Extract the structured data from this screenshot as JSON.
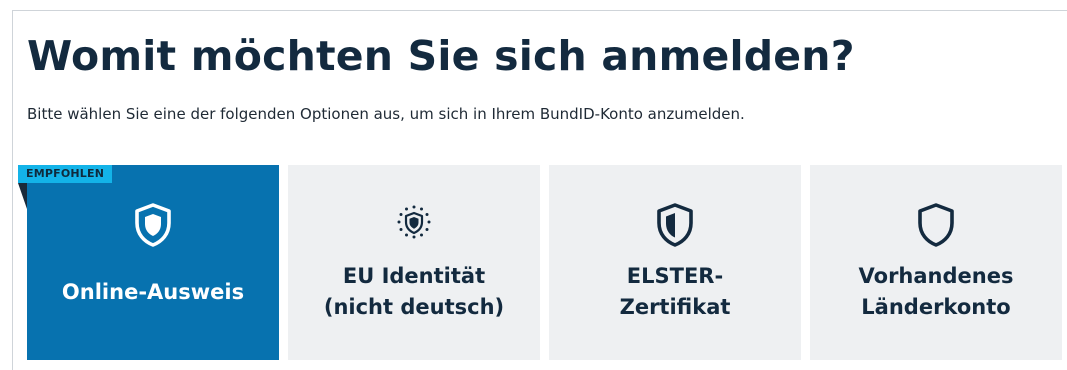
{
  "page": {
    "title": "Womit möchten Sie sich anmelden?",
    "subtitle": "Bitte wählen Sie eine der folgenden Optionen aus, um sich in Ihrem BundID-Konto anzumelden."
  },
  "options": [
    {
      "label_lines": [
        "Online-Ausweis"
      ],
      "icon": "shield-icon",
      "badge": "EMPFOHLEN",
      "selected": true
    },
    {
      "label_lines": [
        "EU Identität",
        "(nicht deutsch)"
      ],
      "icon": "eu-stars-shield-icon",
      "selected": false
    },
    {
      "label_lines": [
        "ELSTER-",
        "Zertifikat"
      ],
      "icon": "half-filled-shield-icon",
      "selected": false
    },
    {
      "label_lines": [
        "Vorhandenes",
        "Länderkonto"
      ],
      "icon": "outline-shield-icon",
      "selected": false
    }
  ],
  "colors": {
    "selected_background": "#0772af",
    "card_background": "#eef0f2",
    "badge_background": "#13b3e8",
    "title_color": "#132a3f"
  }
}
